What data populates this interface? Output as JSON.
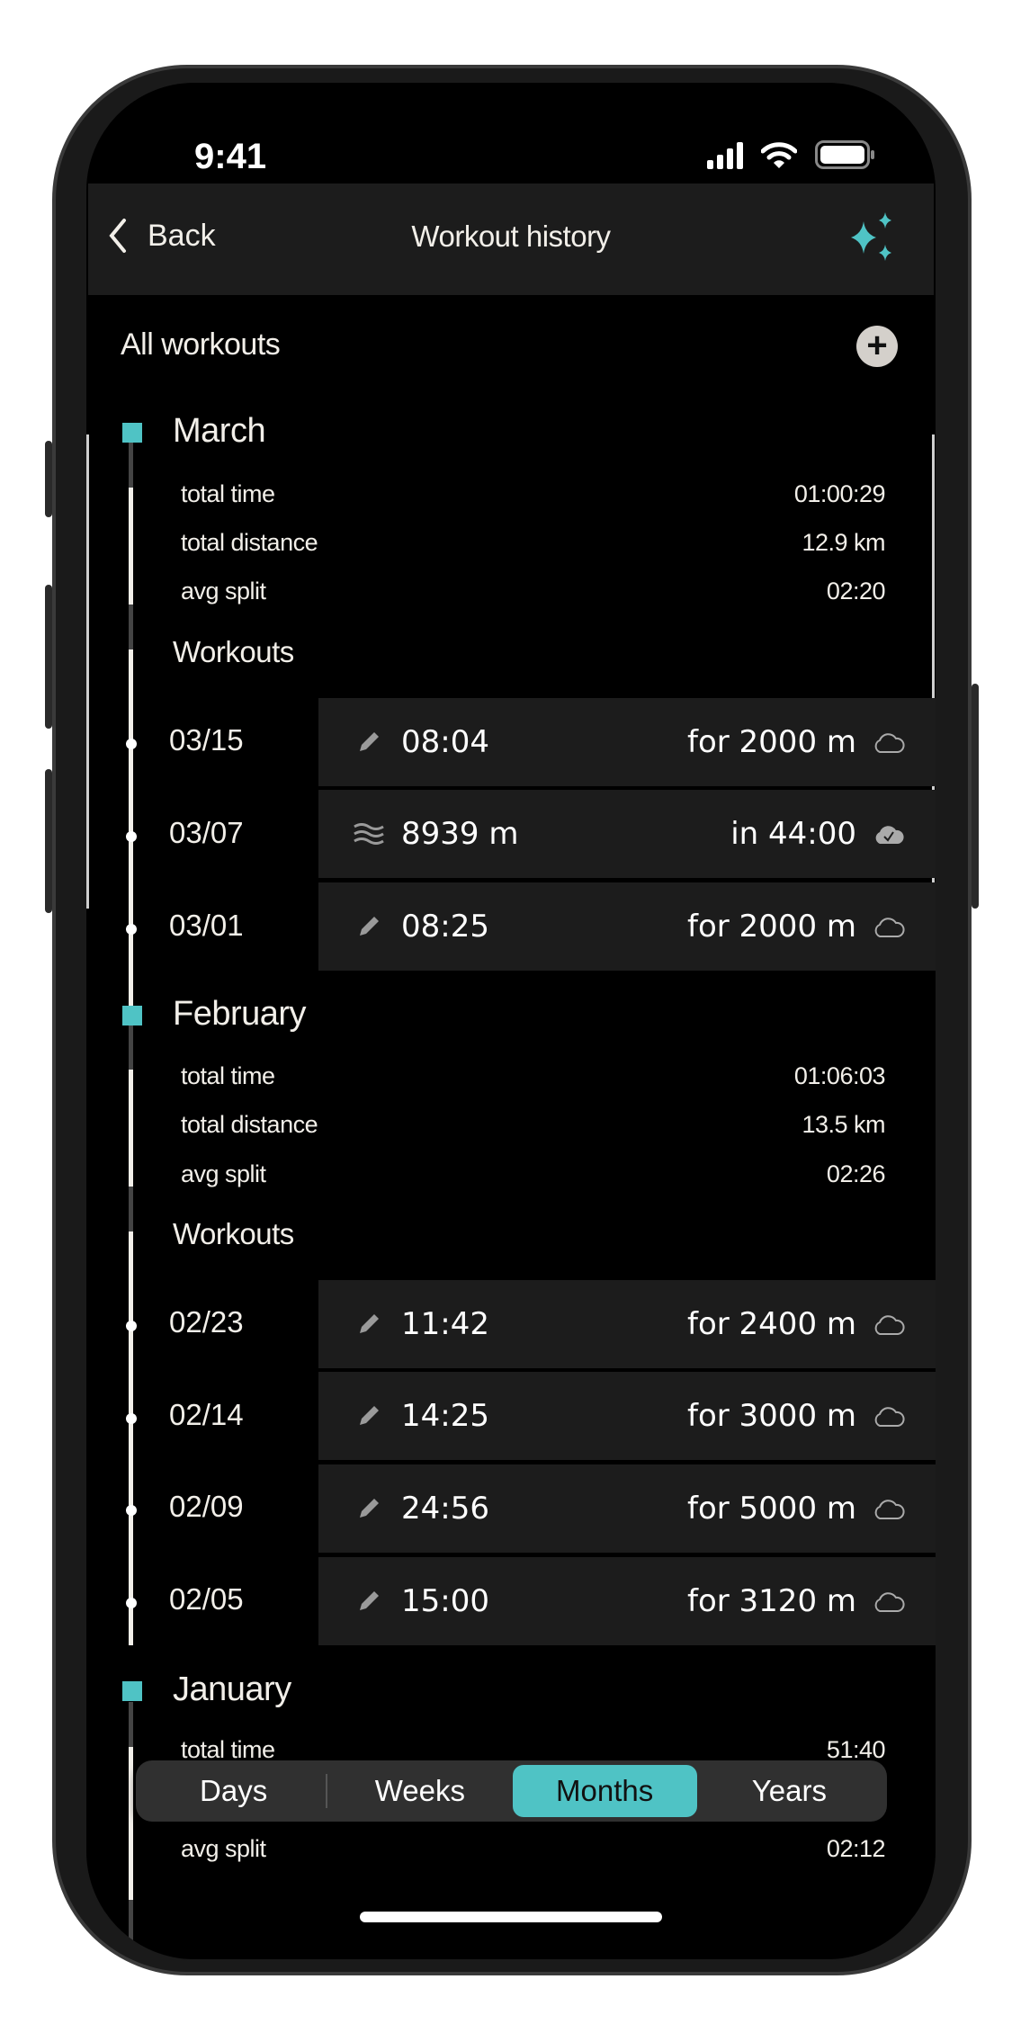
{
  "status": {
    "time": "9:41"
  },
  "nav": {
    "back_label": "Back",
    "title": "Workout history"
  },
  "section": {
    "title": "All workouts"
  },
  "stat_labels": {
    "total_time": "total time",
    "total_distance": "total distance",
    "avg_split": "avg split"
  },
  "workouts_label": "Workouts",
  "months": [
    {
      "name": "March",
      "total_time": "01:00:29",
      "total_distance": "12.9 km",
      "avg_split": "02:20",
      "workouts": [
        {
          "date": "03/15",
          "icon": "pencil-icon",
          "main": "08:04",
          "secondary": "for 2000 m",
          "sync": "cloud-outline-icon"
        },
        {
          "date": "03/07",
          "icon": "waves-icon",
          "main": "8939 m",
          "secondary": "in 44:00",
          "sync": "cloud-check-icon"
        },
        {
          "date": "03/01",
          "icon": "pencil-icon",
          "main": "08:25",
          "secondary": "for 2000 m",
          "sync": "cloud-outline-icon"
        }
      ]
    },
    {
      "name": "February",
      "total_time": "01:06:03",
      "total_distance": "13.5 km",
      "avg_split": "02:26",
      "workouts": [
        {
          "date": "02/23",
          "icon": "pencil-icon",
          "main": "11:42",
          "secondary": "for 2400 m",
          "sync": "cloud-outline-icon"
        },
        {
          "date": "02/14",
          "icon": "pencil-icon",
          "main": "14:25",
          "secondary": "for 3000 m",
          "sync": "cloud-outline-icon"
        },
        {
          "date": "02/09",
          "icon": "pencil-icon",
          "main": "24:56",
          "secondary": "for 5000 m",
          "sync": "cloud-outline-icon"
        },
        {
          "date": "02/05",
          "icon": "pencil-icon",
          "main": "15:00",
          "secondary": "for 3120 m",
          "sync": "cloud-outline-icon"
        }
      ]
    },
    {
      "name": "January",
      "total_time": "51:40",
      "total_distance": "",
      "avg_split": "02:12"
    }
  ],
  "segmented": {
    "options": [
      "Days",
      "Weeks",
      "Months",
      "Years"
    ],
    "selected": "Months"
  },
  "colors": {
    "accent": "#4fc3c5",
    "background": "#000000",
    "card": "#1c1c1c",
    "text": "#f2efe9"
  }
}
